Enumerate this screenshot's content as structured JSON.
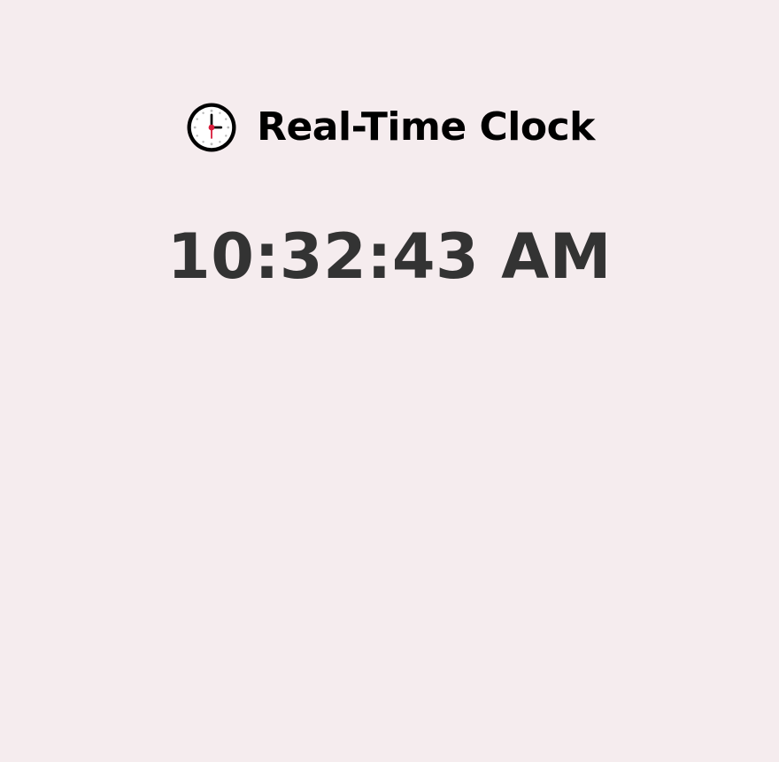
{
  "header": {
    "icon": "clock-icon",
    "title": "Real-Time Clock"
  },
  "clock": {
    "time_text": "10:32:43 AM"
  },
  "colors": {
    "background": "#f5ecee",
    "title_text": "#000000",
    "time_text": "#333333",
    "icon_hand_accent": "#d81b3a",
    "icon_face": "#ffffff",
    "icon_border": "#000000",
    "icon_tick": "#b8b8b8"
  }
}
